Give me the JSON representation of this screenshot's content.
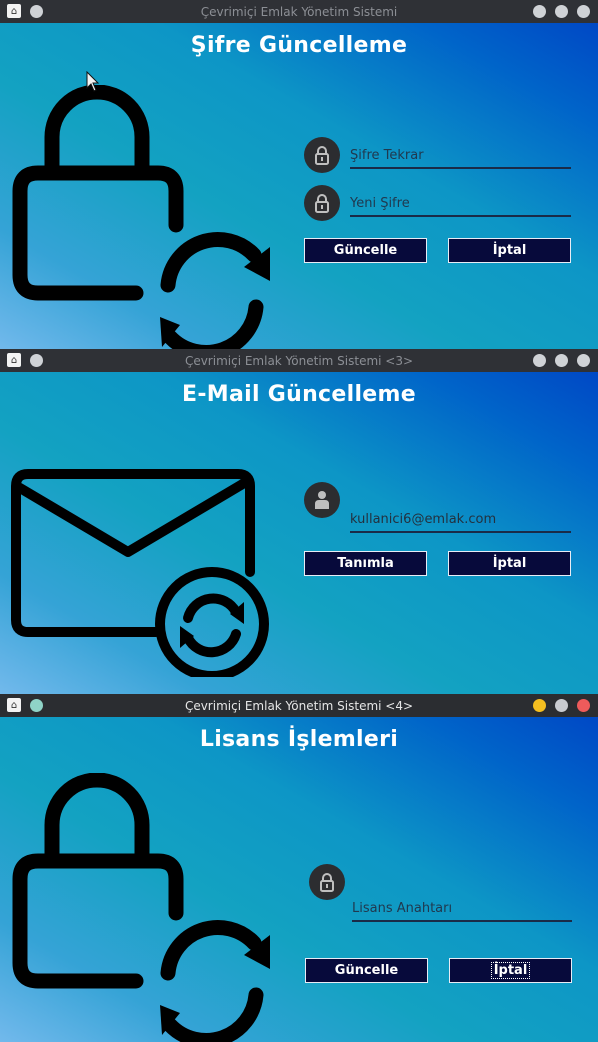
{
  "windows": [
    {
      "title": "Çevrimiçi Emlak Yönetim Sistemi",
      "active": false,
      "heading": "Şifre Güncelleme",
      "fields": [
        {
          "placeholder": "Şifre Tekrar",
          "value": "",
          "icon": "lock-icon"
        },
        {
          "placeholder": "Yeni Şifre",
          "value": "",
          "icon": "lock-icon"
        }
      ],
      "buttons": {
        "primary": "Güncelle",
        "cancel": "İptal"
      },
      "art": "lock-refresh-icon"
    },
    {
      "title": "Çevrimiçi Emlak Yönetim Sistemi <3>",
      "active": false,
      "heading": "E-Mail Güncelleme",
      "fields": [
        {
          "placeholder": "",
          "value": "kullanici6@emlak.com",
          "icon": "user-icon"
        }
      ],
      "buttons": {
        "primary": "Tanımla",
        "cancel": "İptal"
      },
      "art": "mail-refresh-icon"
    },
    {
      "title": "Çevrimiçi Emlak Yönetim Sistemi <4>",
      "active": true,
      "heading": "Lisans İşlemleri",
      "fields": [
        {
          "placeholder": "Lisans Anahtarı",
          "value": "",
          "icon": "lock-icon"
        }
      ],
      "buttons": {
        "primary": "Güncelle",
        "cancel": "İptal"
      },
      "art": "lock-refresh-icon"
    }
  ],
  "colors": {
    "button_bg": "#070a3b",
    "field_underline": "#1a2b48",
    "icon_circle": "#2c2d30",
    "title_active": "#2b2d31",
    "minimize_active": "#f5bf20",
    "close_active": "#ee5b5b"
  }
}
